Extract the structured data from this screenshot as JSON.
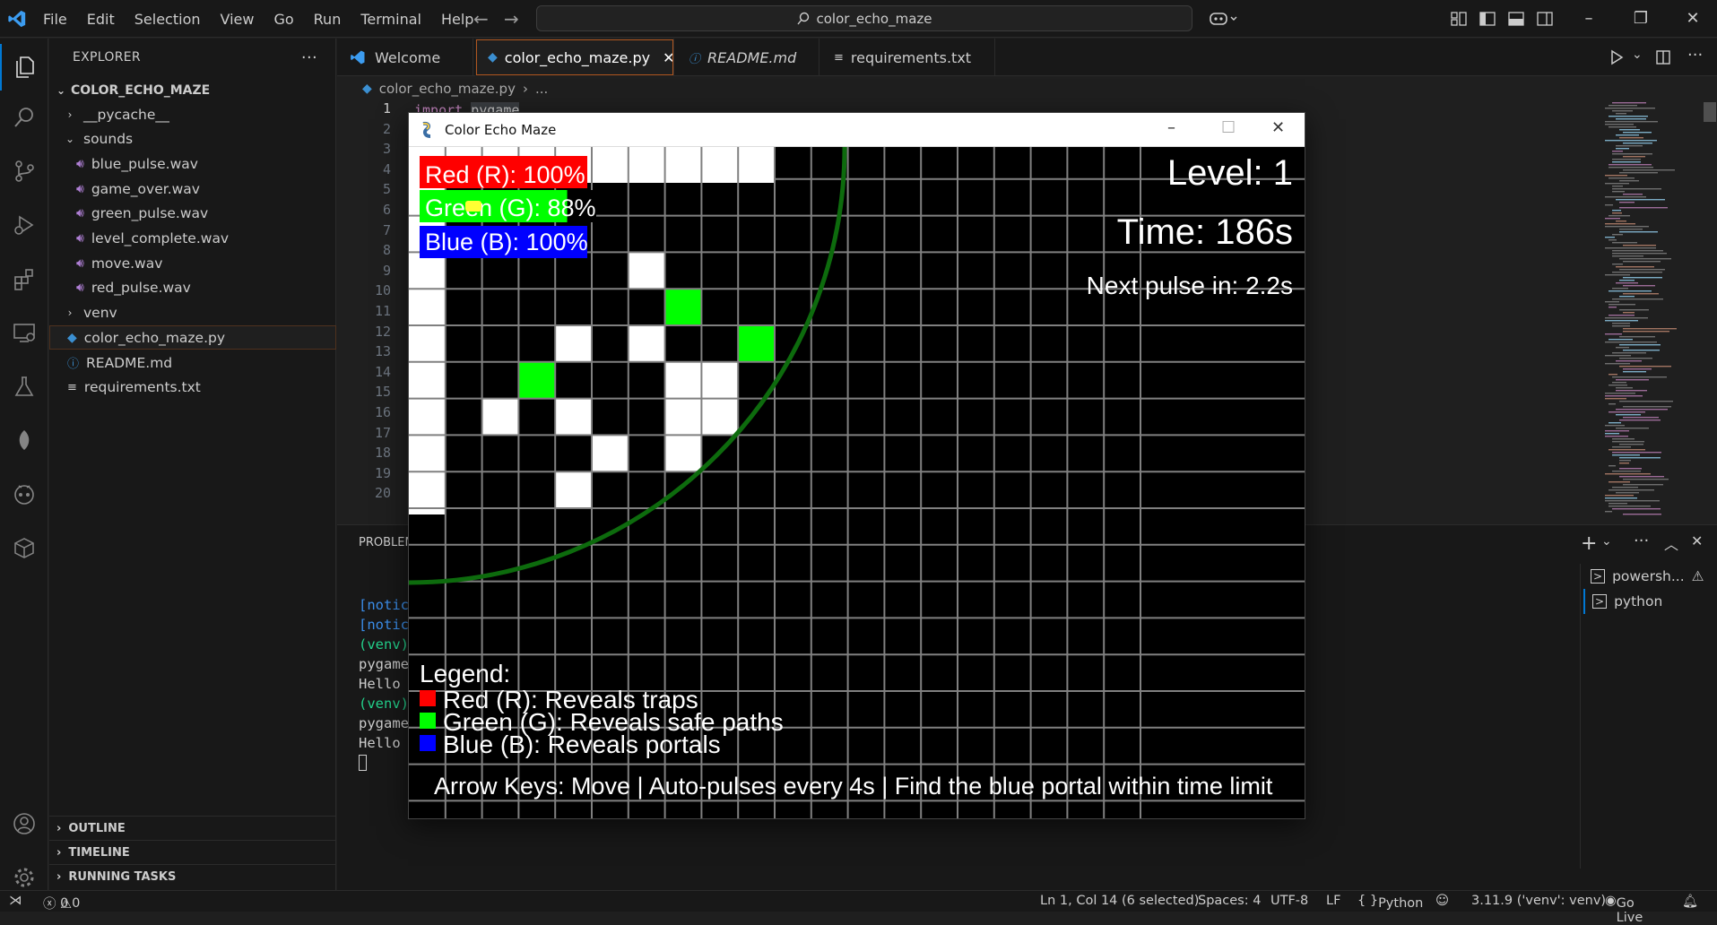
{
  "titlebar": {
    "menu": [
      "File",
      "Edit",
      "Selection",
      "View",
      "Go",
      "Run",
      "Terminal",
      "Help"
    ],
    "search_text": "color_echo_maze"
  },
  "sidebar": {
    "title": "EXPLORER",
    "root": "COLOR_ECHO_MAZE",
    "items": [
      {
        "label": "__pycache__",
        "kind": "folder",
        "depth": 1,
        "expanded": false
      },
      {
        "label": "sounds",
        "kind": "folder",
        "depth": 1,
        "expanded": true
      },
      {
        "label": "blue_pulse.wav",
        "kind": "wav",
        "depth": 2
      },
      {
        "label": "game_over.wav",
        "kind": "wav",
        "depth": 2
      },
      {
        "label": "green_pulse.wav",
        "kind": "wav",
        "depth": 2
      },
      {
        "label": "level_complete.wav",
        "kind": "wav",
        "depth": 2
      },
      {
        "label": "move.wav",
        "kind": "wav",
        "depth": 2
      },
      {
        "label": "red_pulse.wav",
        "kind": "wav",
        "depth": 2
      },
      {
        "label": "venv",
        "kind": "folder",
        "depth": 1,
        "expanded": false
      },
      {
        "label": "color_echo_maze.py",
        "kind": "py",
        "depth": 1,
        "selected": true
      },
      {
        "label": "README.md",
        "kind": "info",
        "depth": 1
      },
      {
        "label": "requirements.txt",
        "kind": "txt",
        "depth": 1
      }
    ],
    "sections": [
      "OUTLINE",
      "TIMELINE",
      "RUNNING TASKS"
    ]
  },
  "tabs": [
    {
      "label": "Welcome",
      "active": false,
      "italic": false
    },
    {
      "label": "color_echo_maze.py",
      "active": true,
      "italic": false
    },
    {
      "label": "README.md",
      "active": false,
      "italic": true
    },
    {
      "label": "requirements.txt",
      "active": false,
      "italic": false
    }
  ],
  "breadcrumb": {
    "file": "color_echo_maze.py",
    "rest": "..."
  },
  "editor": {
    "line_numbers": [
      "1",
      "2",
      "3",
      "4",
      "5",
      "6",
      "7",
      "8",
      "9",
      "10",
      "11",
      "12",
      "13",
      "14",
      "15",
      "16",
      "17",
      "18",
      "19",
      "20"
    ],
    "line1_keyword": "import",
    "line1_module": "pygame"
  },
  "panel": {
    "title": "PROBLEM",
    "terminal_lines": [
      {
        "text": "[notic",
        "color": "#3b8eea"
      },
      {
        "text": "[notic",
        "color": "#3b8eea"
      },
      {
        "text": "(venv)",
        "color": "#23d18b"
      },
      {
        "text": "pygame",
        "color": "#cccccc"
      },
      {
        "text": "Hello",
        "color": "#cccccc"
      },
      {
        "text": "(venv)",
        "color": "#23d18b"
      },
      {
        "text": "pygame",
        "color": "#cccccc"
      },
      {
        "text": "Hello",
        "color": "#cccccc"
      }
    ],
    "terminals": [
      "powersh...",
      "python"
    ]
  },
  "status": {
    "errors": "0",
    "warnings": "0",
    "position": "Ln 1, Col 14 (6 selected)",
    "spaces": "Spaces: 4",
    "encoding": "UTF-8",
    "eol": "LF",
    "language": "Python",
    "interpreter": "3.11.9 ('venv': venv)",
    "golive": "Go Live"
  },
  "game": {
    "window_title": "Color Echo Maze",
    "red_label": "Red (R): 100%",
    "red_value": 100,
    "green_label": "Green (G): 88%",
    "green_value": 88,
    "blue_label": "Blue (B): 100%",
    "blue_value": 100,
    "level": "Level: 1",
    "time": "Time: 186s",
    "next_pulse": "Next pulse in: 2.2s",
    "legend_title": "Legend:",
    "legend": [
      {
        "label": "Red (R): Reveals traps",
        "color": "#ff0000"
      },
      {
        "label": "Green (G): Reveals safe paths",
        "color": "#00ff00"
      },
      {
        "label": "Blue (B): Reveals portals",
        "color": "#0000ff"
      }
    ],
    "instructions": "Arrow Keys: Move | Auto-pulses every 4s | Find the blue portal within time limit",
    "colors": {
      "accent": "#0078d4",
      "safe": "#00ff00",
      "wall": "#ffffff",
      "grid": "#808080"
    }
  }
}
